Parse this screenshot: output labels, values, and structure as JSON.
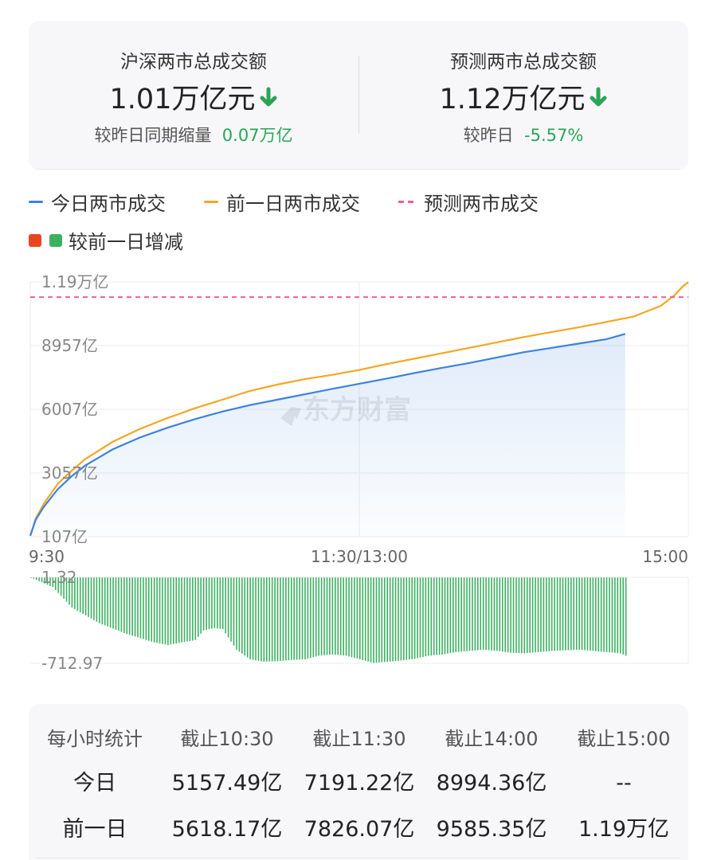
{
  "summary": {
    "left": {
      "title": "沪深两市总成交额",
      "value": "1.01万亿元",
      "sub_label": "较昨日同期缩量",
      "sub_value": "0.07万亿"
    },
    "right": {
      "title": "预测两市总成交额",
      "value": "1.12万亿元",
      "sub_label": "较昨日",
      "sub_value": "-5.57%"
    }
  },
  "legend": {
    "today": "今日两市成交",
    "prev": "前一日两市成交",
    "forecast": "预测两市成交",
    "diff": "较前一日增减"
  },
  "colors": {
    "today": "#3d82dd",
    "prev": "#f5a623",
    "forecast": "#f25c9c",
    "up": "#e8461e",
    "down": "#3bb160"
  },
  "chart_data": [
    {
      "type": "line",
      "y_tick_labels": [
        "1.19万亿",
        "8957亿",
        "6007亿",
        "3057亿",
        "107亿"
      ],
      "x_tick_labels": [
        "9:30",
        "11:30/13:00",
        "15:00"
      ],
      "ylim": [
        107,
        11907
      ],
      "x_range_minutes": [
        0,
        240
      ],
      "grid": true,
      "watermark": "东方财富",
      "series": [
        {
          "name": "今日两市成交",
          "x": [
            0,
            2,
            5,
            10,
            15,
            20,
            30,
            40,
            50,
            60,
            70,
            80,
            90,
            100,
            110,
            120,
            130,
            140,
            150,
            160,
            170,
            180,
            190,
            200,
            210,
            217
          ],
          "values": [
            150,
            900,
            1500,
            2300,
            2900,
            3400,
            4150,
            4700,
            5150,
            5550,
            5900,
            6200,
            6450,
            6700,
            6950,
            7190,
            7430,
            7680,
            7920,
            8150,
            8400,
            8650,
            8850,
            9050,
            9250,
            9500
          ]
        },
        {
          "name": "前一日两市成交",
          "x": [
            0,
            2,
            5,
            10,
            15,
            20,
            30,
            40,
            50,
            60,
            70,
            80,
            90,
            100,
            110,
            120,
            130,
            140,
            150,
            160,
            170,
            180,
            190,
            200,
            210,
            220,
            230,
            235,
            238,
            240
          ],
          "values": [
            150,
            950,
            1650,
            2550,
            3150,
            3700,
            4500,
            5100,
            5600,
            6050,
            6450,
            6850,
            7150,
            7400,
            7600,
            7830,
            8100,
            8350,
            8600,
            8850,
            9100,
            9350,
            9580,
            9800,
            10050,
            10300,
            10800,
            11300,
            11700,
            11900
          ]
        },
        {
          "name": "预测两市成交",
          "values": [
            11200
          ]
        }
      ]
    },
    {
      "type": "bar",
      "name": "较前一日增减",
      "y_tick_labels": [
        "1.32",
        "-712.97"
      ],
      "ylim": [
        -712.97,
        1.32
      ],
      "x_range_minutes": [
        0,
        217
      ],
      "profile_x": [
        0,
        8,
        15,
        25,
        35,
        45,
        50,
        55,
        60,
        63,
        67,
        70,
        75,
        80,
        85,
        90,
        95,
        100,
        105,
        110,
        115,
        120,
        125,
        130,
        135,
        140,
        145,
        150,
        155,
        160,
        165,
        170,
        175,
        180,
        185,
        190,
        195,
        200,
        205,
        210,
        215,
        217
      ],
      "profile_values": [
        0,
        -80,
        -250,
        -380,
        -470,
        -540,
        -560,
        -540,
        -520,
        -440,
        -420,
        -430,
        -600,
        -680,
        -700,
        -695,
        -685,
        -680,
        -650,
        -640,
        -650,
        -680,
        -710,
        -700,
        -690,
        -675,
        -650,
        -640,
        -620,
        -610,
        -600,
        -610,
        -625,
        -630,
        -620,
        -610,
        -605,
        -600,
        -610,
        -620,
        -630,
        -650
      ]
    }
  ],
  "table": {
    "headers": [
      "每小时统计",
      "截止10:30",
      "截止11:30",
      "截止14:00",
      "截止15:00"
    ],
    "rows": [
      [
        "今日",
        "5157.49亿",
        "7191.22亿",
        "8994.36亿",
        "--"
      ],
      [
        "前一日",
        "5618.17亿",
        "7826.07亿",
        "9585.35亿",
        "1.19万亿"
      ]
    ]
  }
}
